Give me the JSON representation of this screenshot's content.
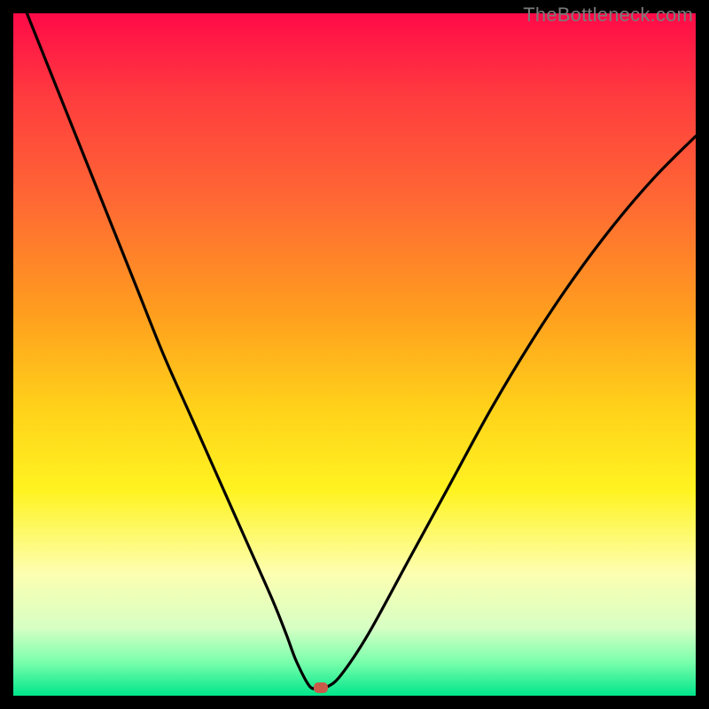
{
  "watermark": "TheBottleneck.com",
  "chart_data": {
    "type": "line",
    "title": "",
    "xlabel": "",
    "ylabel": "",
    "xlim": [
      0,
      100
    ],
    "ylim": [
      0,
      100
    ],
    "series": [
      {
        "name": "curve",
        "x": [
          2,
          6,
          10,
          14,
          18,
          22,
          26,
          30,
          34,
          38,
          40,
          41.5,
          43.5,
          45,
          46,
          48,
          52,
          58,
          64,
          70,
          76,
          82,
          88,
          94,
          100
        ],
        "values": [
          100,
          90,
          80,
          70,
          60,
          50,
          41,
          32,
          23,
          14,
          9,
          5,
          1.3,
          1.3,
          1.3,
          3,
          9,
          20,
          31,
          42,
          52,
          61,
          69,
          76,
          82
        ]
      }
    ],
    "marker": {
      "x": 45,
      "y": 1.2
    },
    "background_gradient": {
      "top": "#ff0a48",
      "mid": "#fff321",
      "bottom": "#00e58a"
    }
  }
}
